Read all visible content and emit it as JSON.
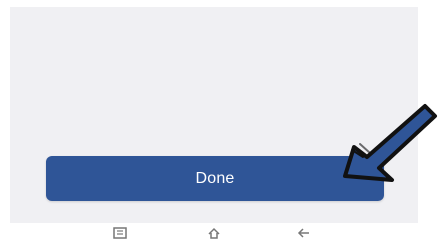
{
  "screen": {
    "background": "#f0f0f3"
  },
  "done_button": {
    "label": "Done",
    "color": "#2f5597"
  },
  "annotation_arrow": {
    "icon": "arrow-pointer-icon",
    "fill_color": "#2f5597",
    "outline_color": "#111111"
  },
  "navbar": {
    "items": [
      {
        "icon": "recents-icon"
      },
      {
        "icon": "home-icon"
      },
      {
        "icon": "back-icon"
      }
    ]
  }
}
